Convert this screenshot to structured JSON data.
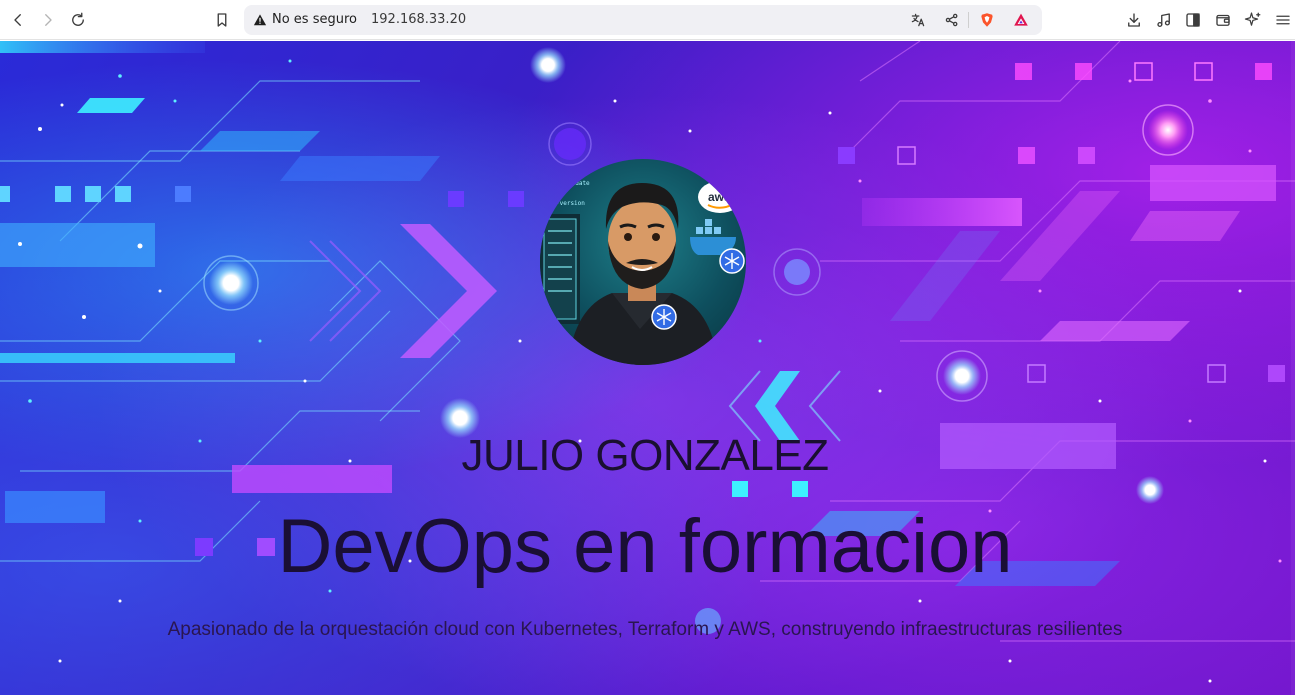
{
  "browser": {
    "security_label": "No es seguro",
    "url": "192.168.33.20",
    "icons": {
      "back": "chevron-left-icon",
      "forward": "chevron-right-icon",
      "reload": "reload-icon",
      "bookmark": "bookmark-icon",
      "warning": "warning-triangle-icon",
      "translate": "translate-icon",
      "share": "share-icon",
      "shields": "brave-shields-icon",
      "rewards": "brave-rewards-icon",
      "downloads": "download-icon",
      "media": "music-note-icon",
      "sidebar": "sidebar-icon",
      "wallet": "wallet-icon",
      "leo": "sparkle-icon",
      "menu": "hamburger-menu-icon"
    },
    "brand_colors": {
      "shields": "#fb542b",
      "rewards_top": "#e0164f",
      "rewards_bottom": "#6b2bd8"
    }
  },
  "hero": {
    "name": "JULIO GONZALEZ",
    "role": "DevOps en formacion",
    "tagline": "Apasionado de la orquestación cloud con Kubernetes, Terraform y AWS, construyendo infraestructuras resilientes",
    "avatar_badge": "aws",
    "avatar_terminal_lines": [
      "update",
      "-version"
    ]
  }
}
